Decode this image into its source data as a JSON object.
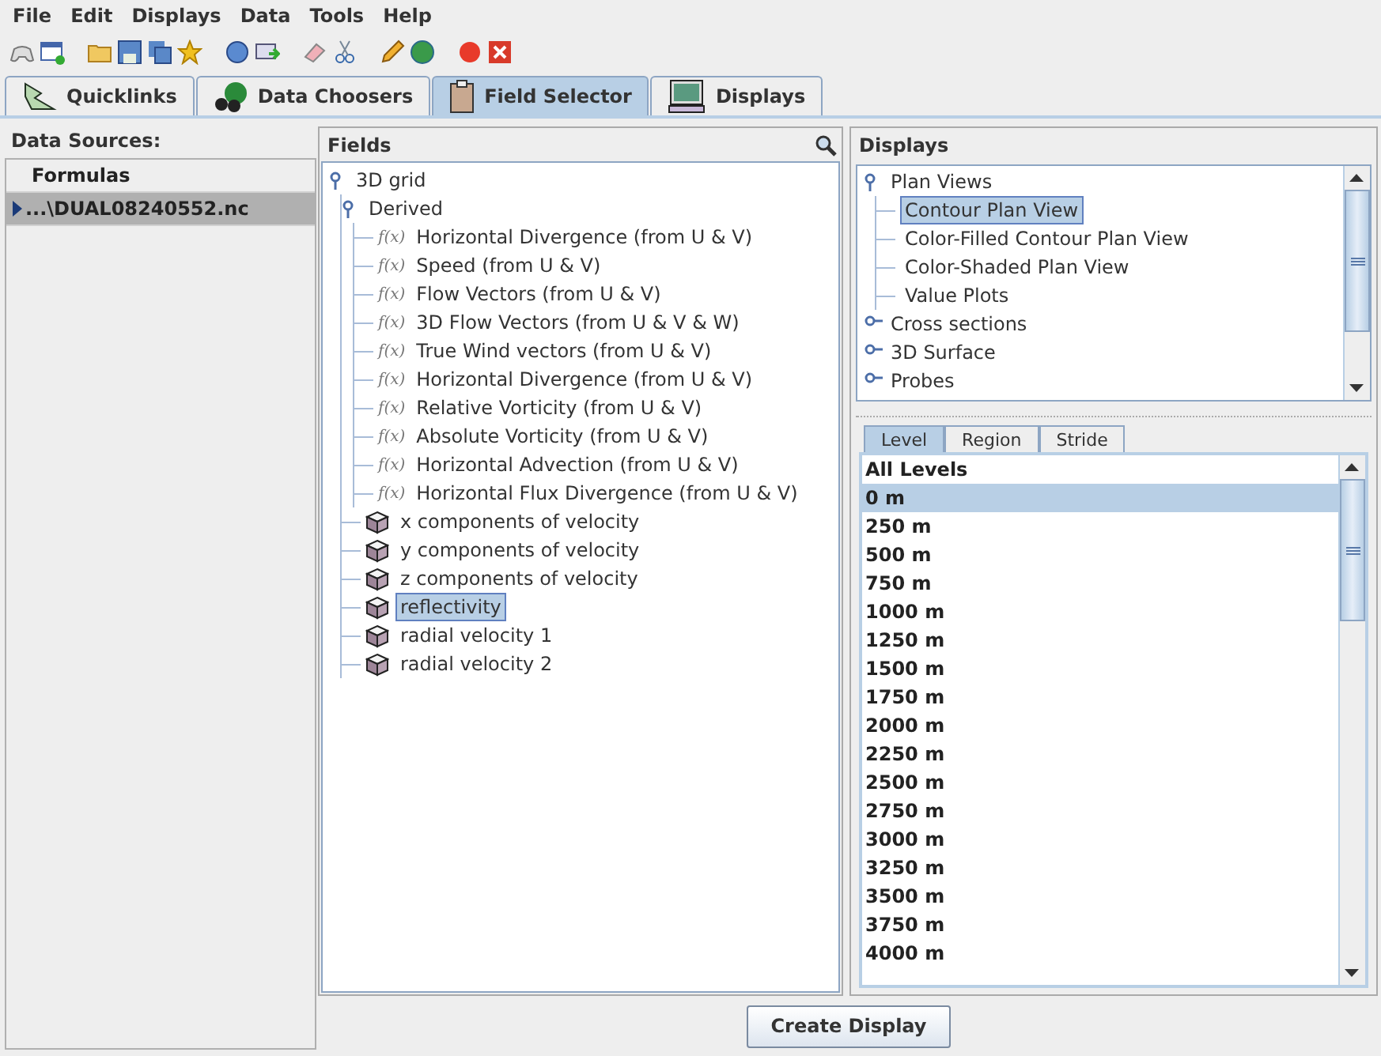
{
  "menu": [
    "File",
    "Edit",
    "Displays",
    "Data",
    "Tools",
    "Help"
  ],
  "tabs": [
    {
      "label": "Quicklinks",
      "selected": false
    },
    {
      "label": "Data Choosers",
      "selected": false
    },
    {
      "label": "Field Selector",
      "selected": true
    },
    {
      "label": "Displays",
      "selected": false
    }
  ],
  "data_sources": {
    "title": "Data Sources:",
    "items": [
      {
        "label": "Formulas",
        "selected": false
      },
      {
        "label": "...\\DUAL08240552.nc",
        "selected": true
      }
    ]
  },
  "fields": {
    "title": "Fields",
    "tree": [
      {
        "label": "3D grid",
        "kind": "folder",
        "expanded": true,
        "selected": false,
        "children": [
          {
            "label": "Derived",
            "kind": "folder",
            "expanded": true,
            "selected": false,
            "children": [
              {
                "label": "Horizontal Divergence (from U & V)",
                "kind": "formula",
                "prefix": "f(x)",
                "selected": false
              },
              {
                "label": "Speed (from U & V)",
                "kind": "formula",
                "prefix": "f(x)",
                "selected": false
              },
              {
                "label": "Flow Vectors (from U & V)",
                "kind": "formula",
                "prefix": "f(x)",
                "selected": false
              },
              {
                "label": "3D Flow Vectors (from U & V & W)",
                "kind": "formula",
                "prefix": "f(x)",
                "selected": false
              },
              {
                "label": "True Wind vectors (from U & V)",
                "kind": "formula",
                "prefix": "f(x)",
                "selected": false
              },
              {
                "label": "Horizontal Divergence (from U & V)",
                "kind": "formula",
                "prefix": "f(x)",
                "selected": false
              },
              {
                "label": "Relative Vorticity (from U & V)",
                "kind": "formula",
                "prefix": "f(x)",
                "selected": false
              },
              {
                "label": "Absolute Vorticity (from U & V)",
                "kind": "formula",
                "prefix": "f(x)",
                "selected": false
              },
              {
                "label": "Horizontal Advection (from U & V)",
                "kind": "formula",
                "prefix": "f(x)",
                "selected": false
              },
              {
                "label": "Horizontal Flux Divergence (from U & V)",
                "kind": "formula",
                "prefix": "f(x)",
                "selected": false
              }
            ]
          },
          {
            "label": "x components of velocity",
            "kind": "grid",
            "selected": false
          },
          {
            "label": "y components of velocity",
            "kind": "grid",
            "selected": false
          },
          {
            "label": "z components of velocity",
            "kind": "grid",
            "selected": false
          },
          {
            "label": "reflectivity",
            "kind": "grid",
            "selected": true
          },
          {
            "label": "radial velocity 1",
            "kind": "grid",
            "selected": false
          },
          {
            "label": "radial velocity 2",
            "kind": "grid",
            "selected": false
          }
        ]
      }
    ]
  },
  "displays": {
    "title": "Displays",
    "tree": [
      {
        "label": "Plan Views",
        "kind": "folder",
        "expanded": true,
        "selected": false,
        "children": [
          {
            "label": "Contour Plan View",
            "selected": true
          },
          {
            "label": "Color-Filled Contour Plan View",
            "selected": false
          },
          {
            "label": "Color-Shaded Plan View",
            "selected": false
          },
          {
            "label": "Value Plots",
            "selected": false
          }
        ]
      },
      {
        "label": "Cross sections",
        "kind": "folder",
        "expanded": false,
        "selected": false
      },
      {
        "label": "3D Surface",
        "kind": "folder",
        "expanded": false,
        "selected": false
      },
      {
        "label": "Probes",
        "kind": "folder",
        "expanded": false,
        "selected": false
      }
    ]
  },
  "subset_tabs": [
    {
      "label": "Level",
      "selected": true
    },
    {
      "label": "Region",
      "selected": false
    },
    {
      "label": "Stride",
      "selected": false
    }
  ],
  "levels": [
    {
      "label": "All Levels",
      "selected": false
    },
    {
      "label": "0 m",
      "selected": true
    },
    {
      "label": "250 m",
      "selected": false
    },
    {
      "label": "500 m",
      "selected": false
    },
    {
      "label": "750 m",
      "selected": false
    },
    {
      "label": "1000 m",
      "selected": false
    },
    {
      "label": "1250 m",
      "selected": false
    },
    {
      "label": "1500 m",
      "selected": false
    },
    {
      "label": "1750 m",
      "selected": false
    },
    {
      "label": "2000 m",
      "selected": false
    },
    {
      "label": "2250 m",
      "selected": false
    },
    {
      "label": "2500 m",
      "selected": false
    },
    {
      "label": "2750 m",
      "selected": false
    },
    {
      "label": "3000 m",
      "selected": false
    },
    {
      "label": "3250 m",
      "selected": false
    },
    {
      "label": "3500 m",
      "selected": false
    },
    {
      "label": "3750 m",
      "selected": false
    },
    {
      "label": "4000 m",
      "selected": false
    }
  ],
  "create_button": "Create Display"
}
